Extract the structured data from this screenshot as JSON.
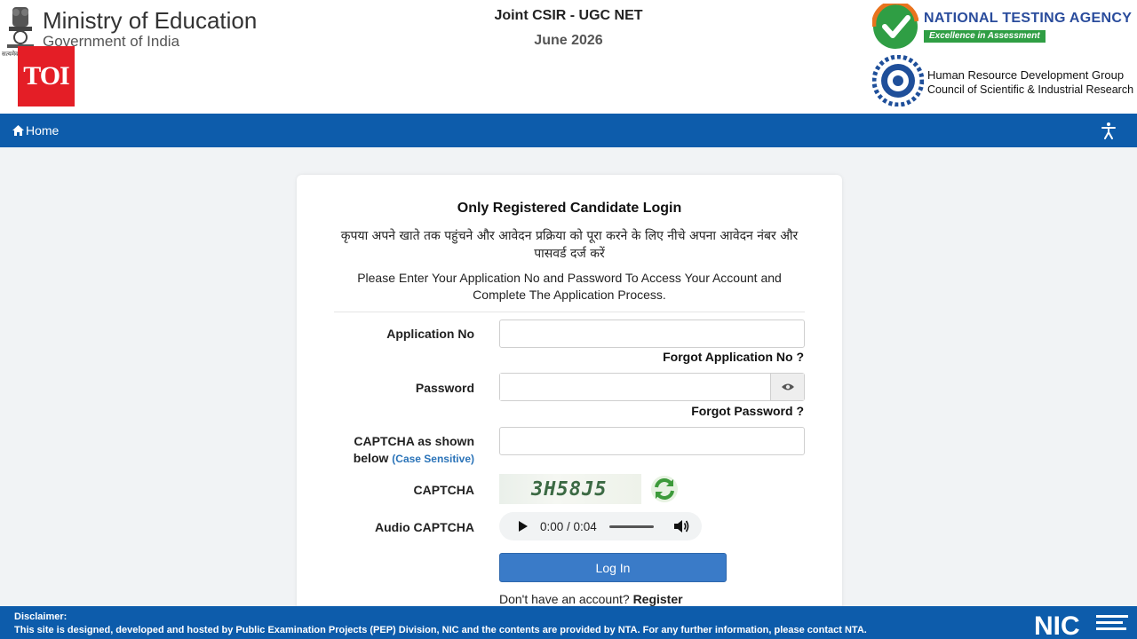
{
  "header": {
    "ministry_title": "Ministry of Education",
    "ministry_sub": "Government of India",
    "emblem_caption": "सत्यमेव",
    "toi_badge": "TOI",
    "exam_title": "Joint CSIR - UGC NET",
    "exam_session": "June 2026",
    "nta_name": "NATIONAL TESTING AGENCY",
    "nta_tagline": "Excellence in Assessment",
    "hrdg_line1": "Human Resource Development Group",
    "hrdg_line2": "Council of Scientific & Industrial Research"
  },
  "nav": {
    "home_label": "Home",
    "home_icon": "home-icon",
    "accessibility_icon": "accessibility-icon"
  },
  "login": {
    "title": "Only Registered Candidate Login",
    "hindi_instruction": "कृपया अपने खाते तक पहुंचने और आवेदन प्रक्रिया को पूरा करने के लिए नीचे अपना आवेदन नंबर और पासवर्ड दर्ज करें",
    "english_instruction": "Please Enter Your Application No and Password To Access Your Account and Complete The Application Process.",
    "application_no_label": "Application No",
    "application_no_value": "",
    "forgot_application_no": "Forgot Application No ?",
    "password_label": "Password",
    "password_value": "",
    "forgot_password": "Forgot Password ?",
    "captcha_input_label": "CAPTCHA as shown below",
    "captcha_input_label_line1": "CAPTCHA as shown",
    "captcha_input_label_line2": "below",
    "captcha_case_hint": "(Case Sensitive)",
    "captcha_input_value": "",
    "captcha_label": "CAPTCHA",
    "captcha_text": "3H58J5",
    "audio_captcha_label": "Audio CAPTCHA",
    "audio_time": "0:00 / 0:04",
    "login_button": "Log In",
    "no_account_text": "Don't have an account?",
    "register_link": "Register"
  },
  "footer": {
    "disclaimer_title": "Disclaimer:",
    "disclaimer_text": "This site is designed, developed and hosted by Public Examination Projects (PEP) Division, NIC and the contents are provided by NTA. For any further information, please contact NTA.",
    "nic_logo_text": "NIC"
  },
  "colors": {
    "nav_blue": "#0d5cab",
    "button_blue": "#3a7bc8",
    "nta_blue": "#2a4c9c",
    "nta_green": "#2f9e44",
    "toi_red": "#e41e26"
  }
}
